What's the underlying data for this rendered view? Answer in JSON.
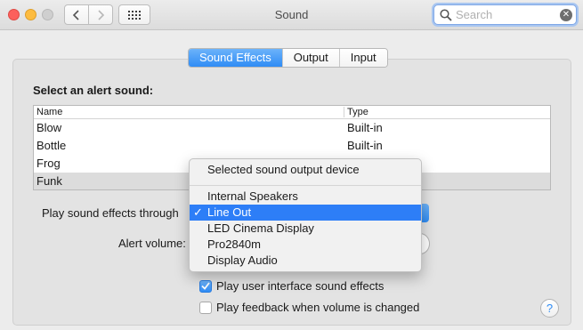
{
  "window": {
    "title": "Sound"
  },
  "search": {
    "placeholder": "Search",
    "value": ""
  },
  "tabs": [
    {
      "label": "Sound Effects",
      "active": true
    },
    {
      "label": "Output",
      "active": false
    },
    {
      "label": "Input",
      "active": false
    }
  ],
  "alert_section": {
    "label": "Select an alert sound:"
  },
  "table": {
    "columns": [
      "Name",
      "Type"
    ],
    "rows": [
      {
        "name": "Blow",
        "type": "Built-in"
      },
      {
        "name": "Bottle",
        "type": "Built-in"
      },
      {
        "name": "Frog",
        "type": ""
      },
      {
        "name": "Funk",
        "type": ""
      }
    ]
  },
  "play_through": {
    "label": "Play sound effects through"
  },
  "alert_volume": {
    "label": "Alert volume:"
  },
  "checkboxes": {
    "ui_sounds": {
      "label": "Play user interface sound effects",
      "checked": true
    },
    "volume_feedback": {
      "label": "Play feedback when volume is changed",
      "checked": false
    }
  },
  "menu": {
    "header": "Selected sound output device",
    "items": [
      {
        "label": "Internal Speakers",
        "selected": false
      },
      {
        "label": "Line Out",
        "selected": true
      },
      {
        "label": "LED Cinema Display",
        "selected": false
      },
      {
        "label": "Pro2840m",
        "selected": false
      },
      {
        "label": "Display Audio",
        "selected": false
      }
    ],
    "check_glyph": "✓"
  },
  "help": {
    "glyph": "?"
  },
  "colors": {
    "accent": "#2d7ef7",
    "close": "#fc605c",
    "minimize": "#fdbc40"
  }
}
